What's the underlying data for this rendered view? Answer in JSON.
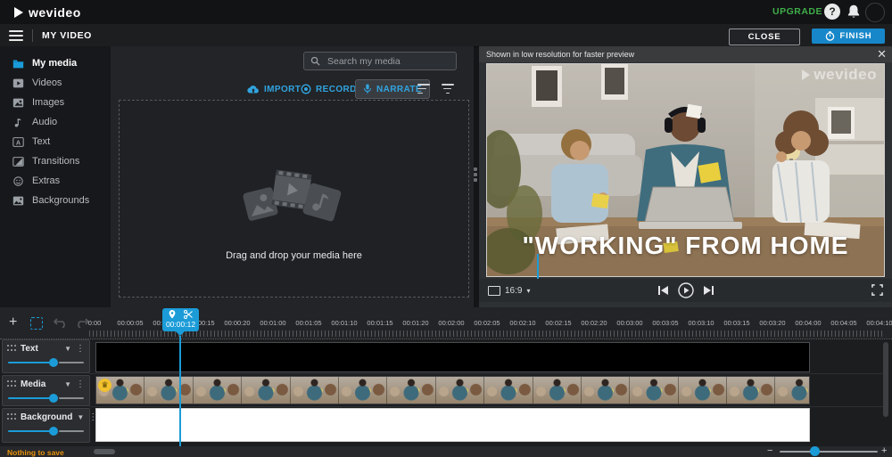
{
  "topbar": {
    "logo": "wevideo",
    "upgrade": "UPGRADE"
  },
  "menubar": {
    "title": "MY VIDEO",
    "close": "CLOSE",
    "finish": "FINISH"
  },
  "sidebar": {
    "items": [
      {
        "label": "My media",
        "icon": "folder-icon",
        "active": true
      },
      {
        "label": "Videos",
        "icon": "video-icon",
        "active": false
      },
      {
        "label": "Images",
        "icon": "image-icon",
        "active": false
      },
      {
        "label": "Audio",
        "icon": "audio-icon",
        "active": false
      },
      {
        "label": "Text",
        "icon": "text-icon",
        "active": false
      },
      {
        "label": "Transitions",
        "icon": "transitions-icon",
        "active": false
      },
      {
        "label": "Extras",
        "icon": "extras-icon",
        "active": false
      },
      {
        "label": "Backgrounds",
        "icon": "backgrounds-icon",
        "active": false
      }
    ]
  },
  "media_panel": {
    "search_placeholder": "Search my media",
    "import_label": "IMPORT",
    "record_label": "RECORD",
    "narrate_label": "NARRATE",
    "dropzone_text": "Drag and drop your media here"
  },
  "preview": {
    "notice": "Shown in low resolution for faster preview",
    "watermark": "wevideo",
    "overlay_text": "\"WORKING\" FROM HOME",
    "aspect_label": "16:9"
  },
  "timeline": {
    "playhead_time": "00:00:12",
    "ruler_labels": [
      "0:00",
      "00:00:05",
      "00:00:10",
      "00:00:15",
      "00:00:20",
      "00:01:00",
      "00:01:05",
      "00:01:10",
      "00:01:15",
      "00:01:20",
      "00:02:00",
      "00:02:05",
      "00:02:10",
      "00:02:15",
      "00:02:20",
      "00:03:00",
      "00:03:05",
      "00:03:10",
      "00:03:15",
      "00:03:20",
      "00:04:00",
      "00:04:05",
      "00:04:10"
    ],
    "tracks": [
      {
        "name": "Text"
      },
      {
        "name": "Media"
      },
      {
        "name": "Background"
      }
    ],
    "status_text": "Nothing to save"
  },
  "colors": {
    "accent_blue": "#1b9cd8",
    "finish_blue": "#1787c9",
    "upgrade_green": "#3fae49",
    "status_orange": "#e8920c"
  }
}
